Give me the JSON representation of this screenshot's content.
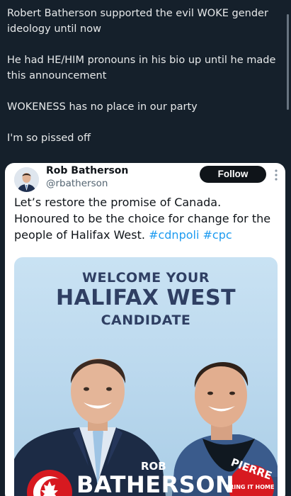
{
  "post": {
    "paragraphs": [
      "Robert Batherson supported the evil WOKE gender ideology until now",
      "He had HE/HIM pronouns in his bio up until he made this announcement",
      "WOKENESS has no place in our party",
      "I'm so pissed off"
    ]
  },
  "embed": {
    "author_name": "Rob Batherson",
    "handle": "@rbatherson",
    "follow_label": "Follow",
    "text": "Let’s restore the promise of Canada. Honoured to be the choice for change for the people of Halifax West.",
    "hashtags": [
      "#cdnpoli",
      "#cpc"
    ]
  },
  "promo": {
    "line1": "WELCOME YOUR",
    "line2": "HALIFAX WEST",
    "line3": "CANDIDATE",
    "badge_first": "ROB",
    "badge_last": "BATHERSON",
    "pierre": "PIERRE",
    "tagline": "BRING IT HOME"
  },
  "colors": {
    "background": "#15202b",
    "text": "#e7e9ea",
    "link": "#1d9bf0",
    "promo_text": "#2f3f63",
    "party_red": "#d71920"
  },
  "icons": {
    "more": "more-vertical-icon",
    "maple_leaf": "maple-leaf-icon"
  }
}
